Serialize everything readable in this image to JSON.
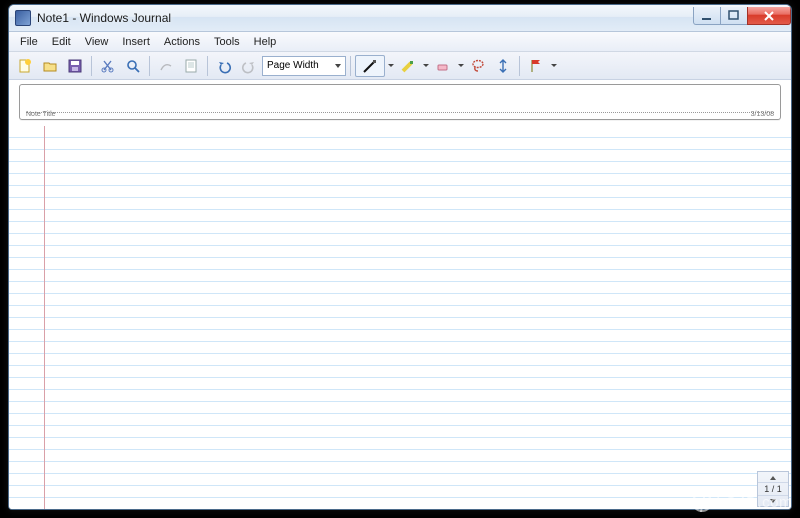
{
  "window": {
    "title": "Note1 - Windows Journal"
  },
  "menu": {
    "items": [
      "File",
      "Edit",
      "View",
      "Insert",
      "Actions",
      "Tools",
      "Help"
    ]
  },
  "toolbar": {
    "zoom_value": "Page Width"
  },
  "note": {
    "title_label": "Note Title",
    "date": "3/13/08"
  },
  "page_nav": {
    "text": "1 / 1"
  },
  "watermark": {
    "text": "LO4D.com"
  }
}
